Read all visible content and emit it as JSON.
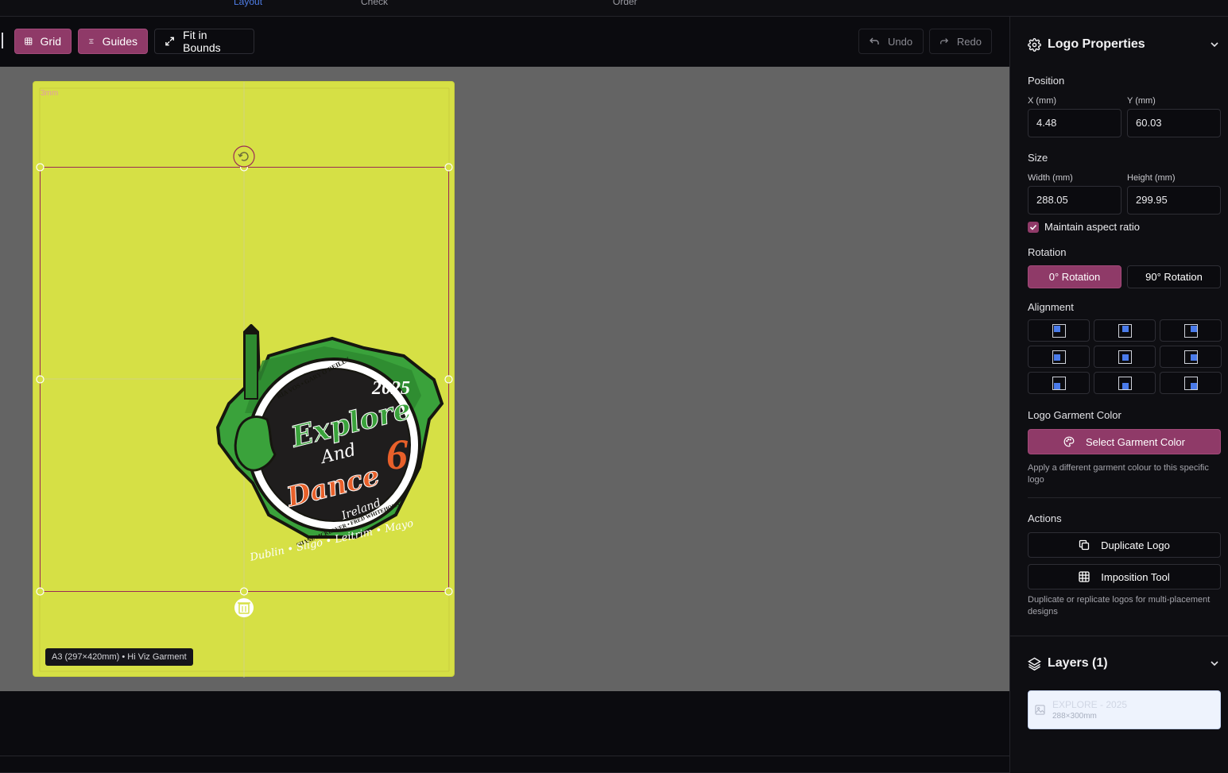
{
  "steps": [
    "Layout",
    "Check",
    "Order"
  ],
  "toolbar": {
    "grid_label": "Grid",
    "guides_label": "Guides",
    "fit_label": "Fit in Bounds",
    "undo_label": "Undo",
    "redo_label": "Redo"
  },
  "canvas": {
    "bleed_label": "3mm",
    "page_label": "A3 (297×420mm) • Hi Viz Garment",
    "garment_color": "#d6e045"
  },
  "logo_art": {
    "year": "2025",
    "line1": "Explore",
    "line2": "And",
    "line3": "Dance",
    "number": "6",
    "country": "Ireland",
    "top_names": "RIA VOS • GARY O'REILLY",
    "bottom_names": "SHANE MCKEEVER • FRED WHITEHORN",
    "places": "Dublin • Sligo • Leitrim • Mayo"
  },
  "panel": {
    "title": "Logo Properties",
    "position_heading": "Position",
    "x_label": "X (mm)",
    "y_label": "Y (mm)",
    "x_value": "4.48",
    "y_value": "60.03",
    "size_heading": "Size",
    "width_label": "Width (mm)",
    "height_label": "Height (mm)",
    "width_value": "288.05",
    "height_value": "299.95",
    "aspect_label": "Maintain aspect ratio",
    "aspect_checked": true,
    "rotation_heading": "Rotation",
    "rot0_label": "0° Rotation",
    "rot90_label": "90° Rotation",
    "alignment_heading": "Alignment",
    "color_heading": "Logo Garment Color",
    "color_button": "Select Garment Color",
    "color_help": "Apply a different garment colour to this specific logo",
    "actions_heading": "Actions",
    "duplicate_button": "Duplicate Logo",
    "imposition_button": "Imposition Tool",
    "actions_help": "Duplicate or replicate logos for multi-placement designs",
    "layers_title": "Layers (1)",
    "layer_name": "EXPLORE - 2025",
    "layer_size": "288×300mm"
  },
  "colors": {
    "accent": "#8f3a68",
    "align_dot": "#4a7bea",
    "selection": "#9b2a55"
  }
}
